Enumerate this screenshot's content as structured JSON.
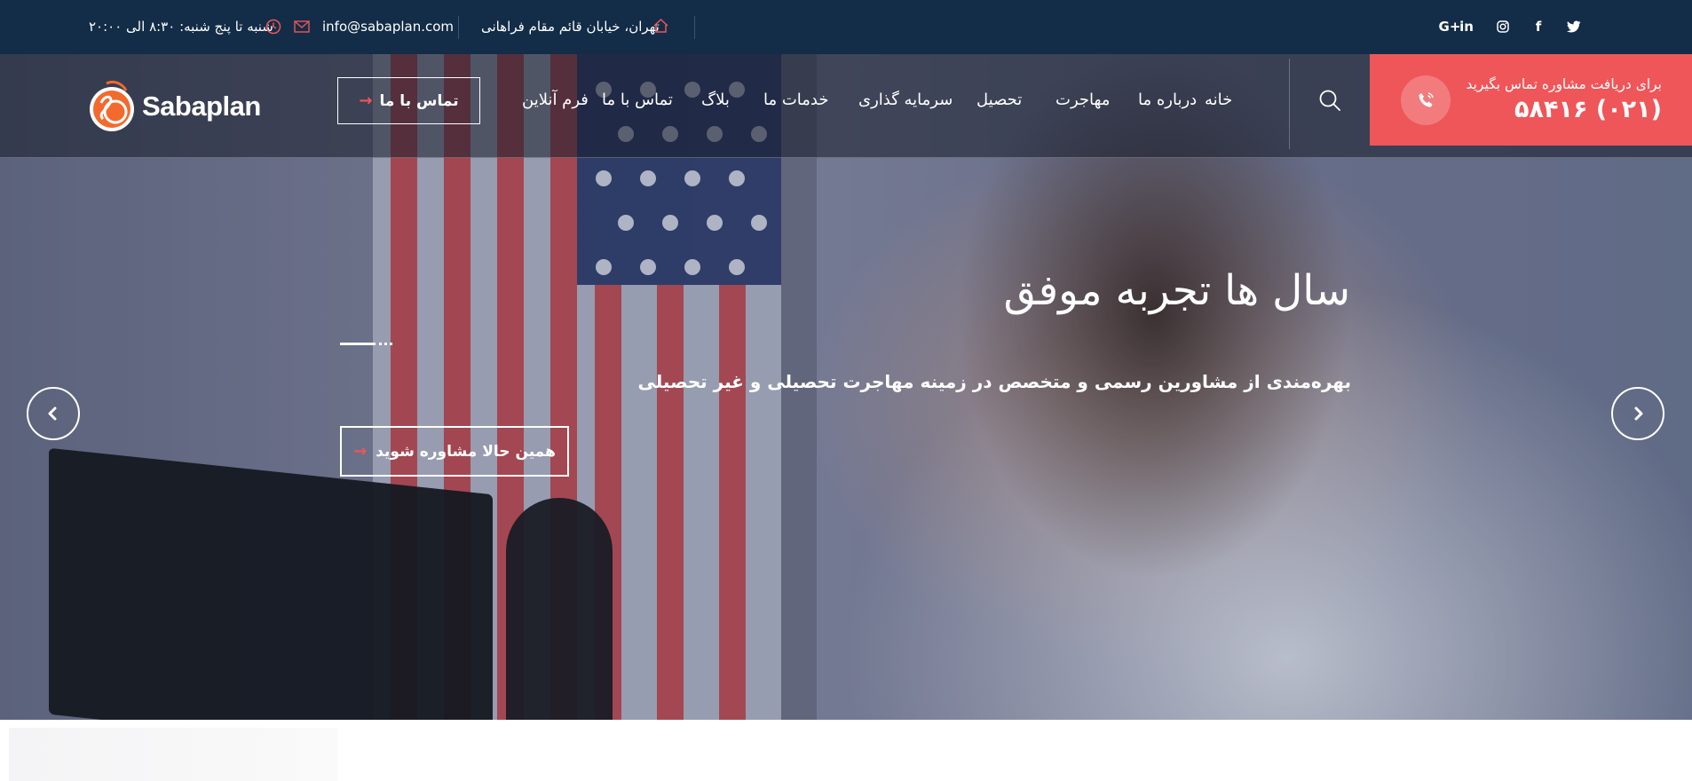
{
  "topbar": {
    "hours": "شنبه تا پنج شنبه: ۸:۳۰ الی ۲۰:۰۰",
    "email": "info@sabaplan.com",
    "address": "تهران، خیابان قائم مقام فراهانی",
    "social": [
      {
        "icon": "google-plus-icon",
        "label": "G+"
      },
      {
        "icon": "linkedin-icon",
        "label": "in"
      },
      {
        "icon": "instagram-icon"
      },
      {
        "icon": "facebook-icon",
        "label": "f"
      },
      {
        "icon": "twitter-icon"
      }
    ]
  },
  "header": {
    "logo_text": "Sabaplan",
    "contact_button": "تماس با ما",
    "nav": [
      "خانه",
      "درباره ما",
      "مهاجرت",
      "تحصیل",
      "سرمایه گذاری",
      "خدمات ما",
      "بلاگ",
      "تماس با ما",
      "فرم آنلاین"
    ],
    "call_caption": "برای دریافت مشاوره تماس بگیرید",
    "call_number": "(۰۲۱) ۵۸۴۱۶"
  },
  "hero": {
    "title": "سال ها تجربه موفق",
    "subtitle": "بهره‌مندی از مشاورین رسمی و متخصص در زمینه مهاجرت تحصیلی و غیر تحصیلی",
    "cta": "همین حالا مشاوره شوید"
  },
  "colors": {
    "topbar": "#132c47",
    "accent": "#ef5659",
    "logo_orange": "#f26a2e"
  }
}
